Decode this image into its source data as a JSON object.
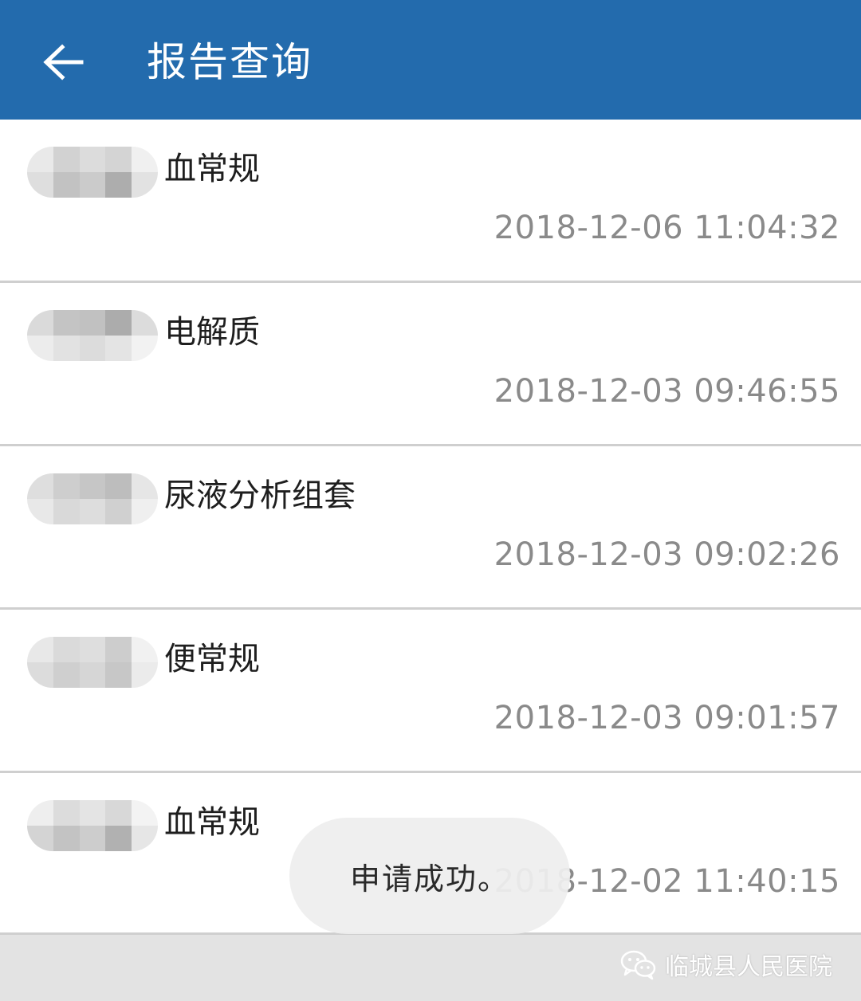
{
  "header": {
    "title": "报告查询",
    "back_icon": "arrow-left-icon",
    "background": "#236bad"
  },
  "reports": [
    {
      "name": "血常规",
      "time": "2018-12-06 11:04:32"
    },
    {
      "name": "电解质",
      "time": "2018-12-03 09:46:55"
    },
    {
      "name": "尿液分析组套",
      "time": "2018-12-03 09:02:26"
    },
    {
      "name": "便常规",
      "time": "2018-12-03 09:01:57"
    },
    {
      "name": "血常规",
      "time": "2018-12-02 11:40:15"
    }
  ],
  "toast": {
    "message": "申请成功。"
  },
  "watermark": {
    "text": "临城县人民医院",
    "icon": "wechat-icon"
  }
}
